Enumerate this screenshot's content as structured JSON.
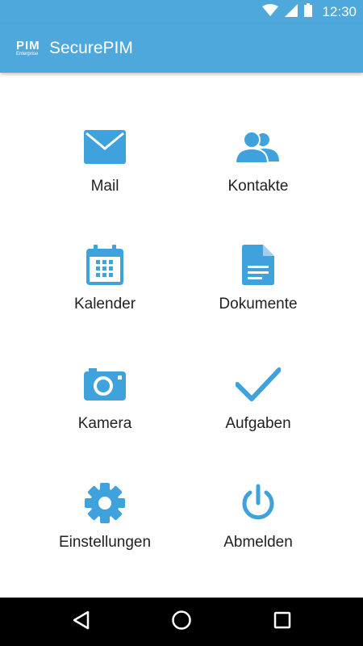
{
  "status_bar": {
    "time": "12:30",
    "icons": [
      "wifi-icon",
      "signal-icon",
      "battery-icon"
    ]
  },
  "app_bar": {
    "logo_text": "PIM",
    "logo_subtext": "Enterprise",
    "title": "SecurePIM"
  },
  "menu": {
    "items": [
      {
        "label": "Mail",
        "icon": "mail-icon"
      },
      {
        "label": "Kontakte",
        "icon": "contacts-icon"
      },
      {
        "label": "Kalender",
        "icon": "calendar-icon"
      },
      {
        "label": "Dokumente",
        "icon": "document-icon"
      },
      {
        "label": "Kamera",
        "icon": "camera-icon"
      },
      {
        "label": "Aufgaben",
        "icon": "checkmark-icon"
      },
      {
        "label": "Einstellungen",
        "icon": "gear-icon"
      },
      {
        "label": "Abmelden",
        "icon": "power-icon"
      }
    ]
  },
  "nav_bar": {
    "icons": [
      "back-icon",
      "home-icon",
      "recents-icon"
    ]
  },
  "colors": {
    "primary": "#4ea8dc",
    "icon": "#3fa2dd",
    "text": "#222222",
    "nav_bar": "#000000"
  }
}
